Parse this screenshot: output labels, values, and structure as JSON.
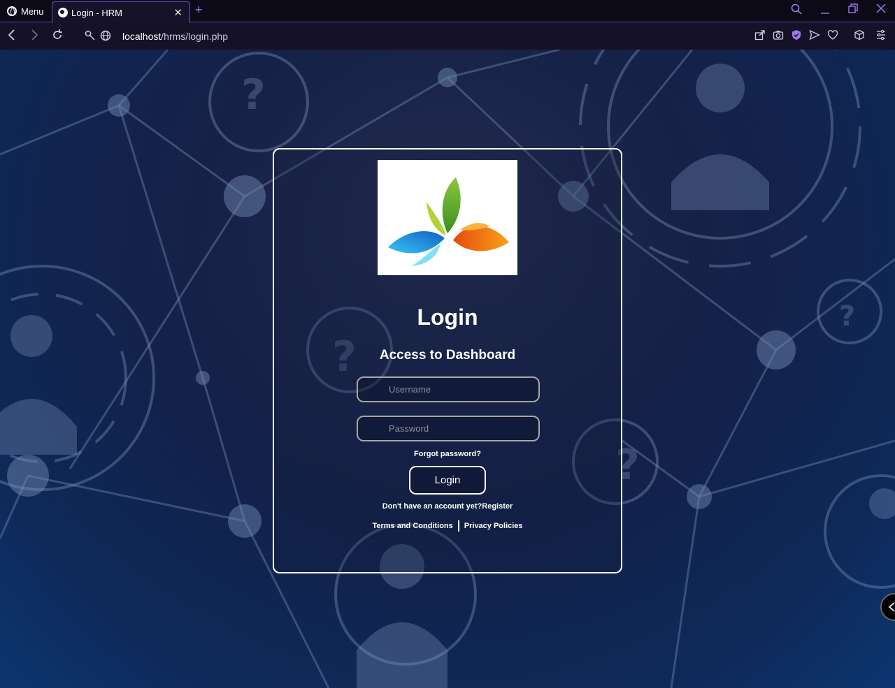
{
  "browser": {
    "menu_label": "Menu",
    "tab_title": "Login - HRM",
    "url_host": "localhost",
    "url_path": "/hrms/login.php"
  },
  "login": {
    "title": "Login",
    "subtitle": "Access to Dashboard",
    "username_placeholder": "Username",
    "password_placeholder": "Password",
    "forgot_label": "Forgot password?",
    "login_button": "Login",
    "register_prompt": "Don't have an account yet?",
    "register_link": "Register",
    "terms_link": "Terms and Conditions",
    "privacy_link": "Privacy Policies"
  },
  "colors": {
    "accent": "#9b7cf0",
    "card_border": "#ffffff",
    "background_dark": "#132048"
  }
}
